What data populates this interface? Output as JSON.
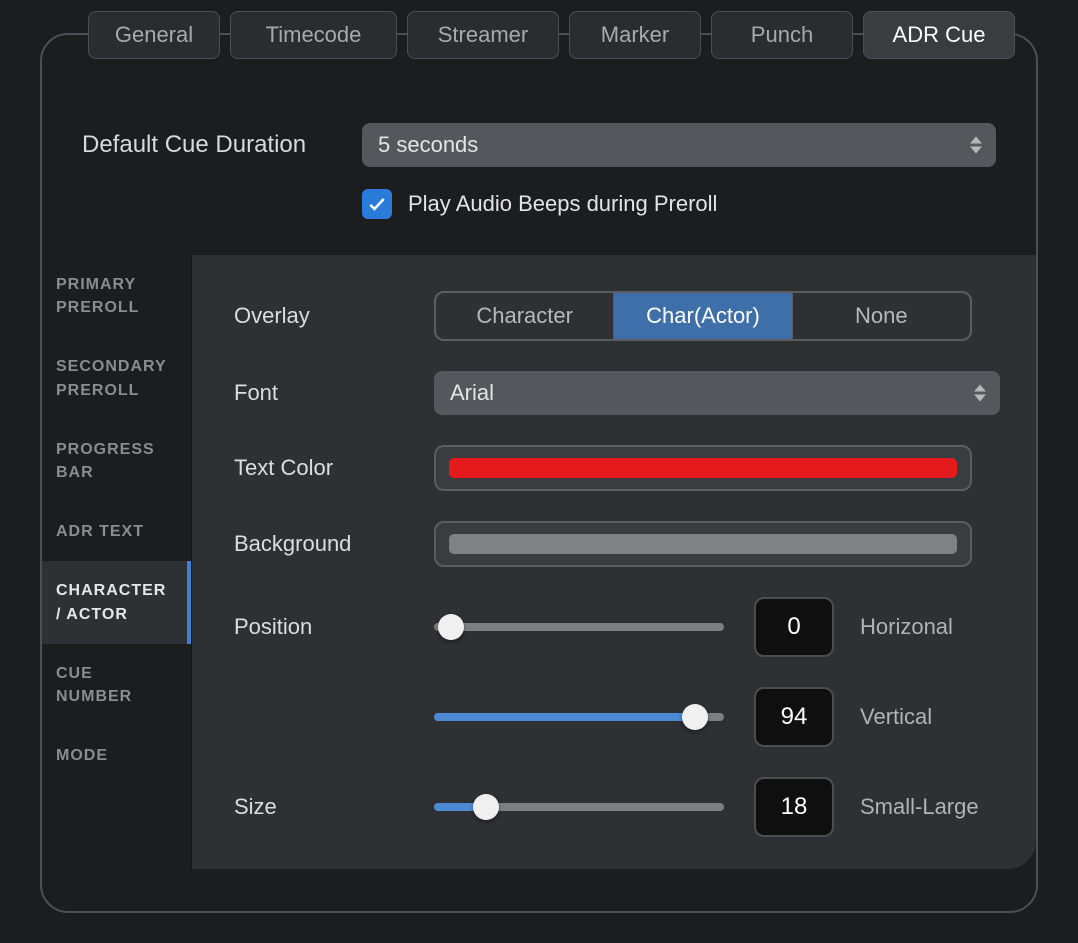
{
  "tabs": {
    "items": [
      "General",
      "Timecode",
      "Streamer",
      "Marker",
      "Punch",
      "ADR Cue"
    ],
    "active_index": 5
  },
  "top": {
    "default_cue_duration_label": "Default Cue Duration",
    "default_cue_duration_value": "5 seconds",
    "play_beeps_label": "Play Audio Beeps during Preroll",
    "play_beeps_checked": true
  },
  "sidebar": {
    "items": [
      "PRIMARY PREROLL",
      "SECONDARY PREROLL",
      "PROGRESS BAR",
      "ADR TEXT",
      "CHARACTER / ACTOR",
      "CUE NUMBER",
      "MODE"
    ],
    "active_index": 4
  },
  "content": {
    "overlay_label": "Overlay",
    "overlay_options": [
      "Character",
      "Char(Actor)",
      "None"
    ],
    "overlay_active_index": 1,
    "font_label": "Font",
    "font_value": "Arial",
    "text_color_label": "Text Color",
    "text_color_value": "#e51b1b",
    "background_label": "Background",
    "background_value": "#808184",
    "position_label": "Position",
    "position_h_value": "0",
    "position_h_suffix": "Horizonal",
    "position_v_value": "94",
    "position_v_suffix": "Vertical",
    "size_label": "Size",
    "size_value": "18",
    "size_suffix": "Small-Large"
  }
}
